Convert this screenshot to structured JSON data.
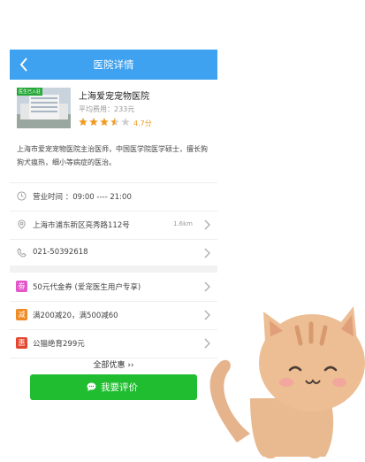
{
  "header": {
    "title": "医院详情",
    "back_icon": "back-arrow-icon"
  },
  "hospital": {
    "image_badge": "医生已入驻",
    "name": "上海爱宠宠物医院",
    "avg_cost": "平均费用：233元",
    "rating_value": 3.5,
    "rating_max": 5,
    "rating_text": "4.7分",
    "description": "上海市爱宠宠物医院主治医师，中国医学院医学硕士，擅长狗狗犬瘟热，细小等病症的医治。"
  },
  "info": {
    "hours": "营业时间 ：09:00 ---- 21:00",
    "address": "上海市浦东新区亮秀路112号",
    "distance": "1.6km",
    "phone": "021-50392618"
  },
  "offers": [
    {
      "tag": "劵",
      "color": "#e356c9",
      "text": "50元代金券 (爱宠医生用户专享)"
    },
    {
      "tag": "减",
      "color": "#f08a22",
      "text": "满200减20，满500减60"
    },
    {
      "tag": "惠",
      "color": "#e4472f",
      "text": "公猫绝育299元"
    }
  ],
  "more_label": "全部优惠 ››",
  "review_button": "我要评价",
  "colors": {
    "header": "#3ea2f0",
    "button": "#1fbd2f",
    "star": "#f29a1e"
  }
}
